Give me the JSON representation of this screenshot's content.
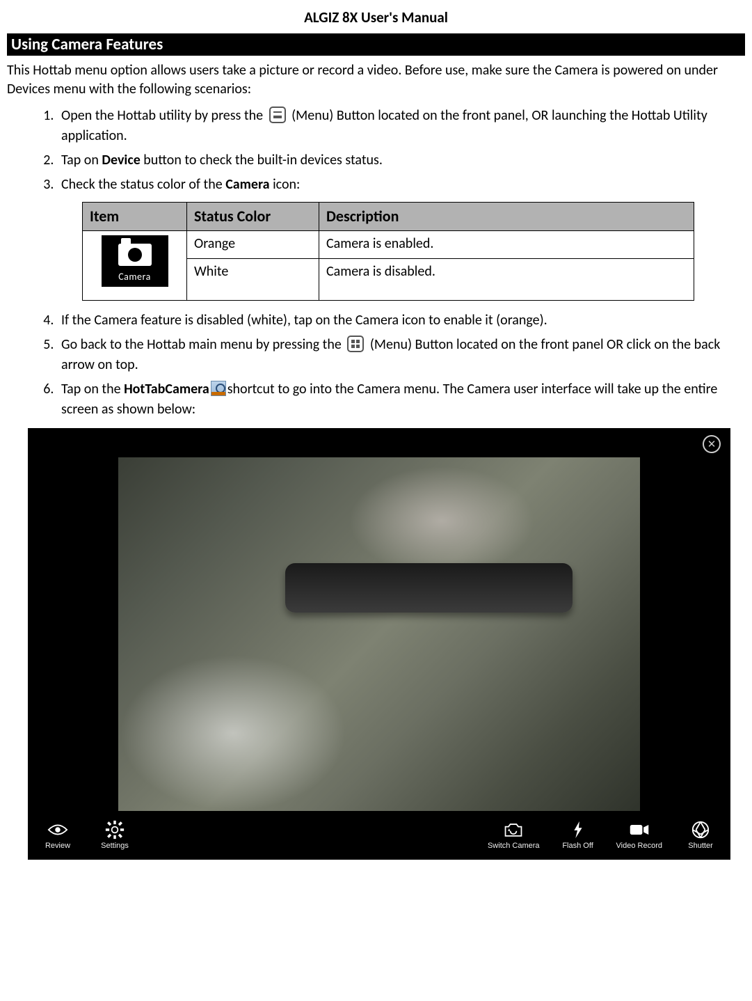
{
  "header": {
    "title": "ALGIZ 8X User's Manual"
  },
  "section": {
    "heading": "Using Camera Features"
  },
  "intro": "This Hottab menu option allows users take a picture or record a video. Before use, make sure the Camera is powered on under Devices menu with the following scenarios:",
  "steps": {
    "s1a": "Open the Hottab utility by press the ",
    "s1b": " (Menu) Button located on the front panel, OR launching the Hottab Utility application.",
    "s2a": "Tap on ",
    "s2_bold": "Device",
    "s2b": " button to check the built-in devices status.",
    "s3a": "Check the status color of the ",
    "s3_bold": "Camera",
    "s3b": " icon:",
    "s4": "If the Camera feature is disabled (white), tap on the Camera icon to enable it (orange).",
    "s5a": "Go back to the Hottab main menu by pressing the ",
    "s5b": " (Menu) Button located on the front panel OR click on the back arrow on top.",
    "s6a": "Tap on the ",
    "s6_bold": "HotTabCamera",
    "s6b": "shortcut to go into the Camera menu. The Camera user interface will take up the entire screen as shown below:"
  },
  "table": {
    "headers": {
      "item": "Item",
      "color": "Status Color",
      "desc": "Description"
    },
    "camera_label": "Camera",
    "rows": [
      {
        "color": "Orange",
        "desc": "Camera is enabled."
      },
      {
        "color": "White",
        "desc": "Camera is disabled."
      }
    ]
  },
  "camera_ui": {
    "toolbar": {
      "review": "Review",
      "settings": "Settings",
      "switch": "Switch Camera",
      "flash": "Flash Off",
      "record": "Video Record",
      "shutter": "Shutter"
    }
  }
}
